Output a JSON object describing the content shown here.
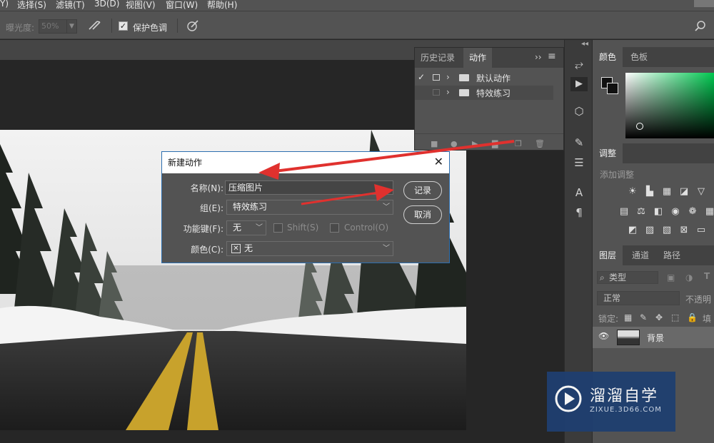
{
  "menu": [
    "Y)",
    "选择(S)",
    "滤镜(T)",
    "3D(D)",
    "视图(V)",
    "窗口(W)",
    "帮助(H)"
  ],
  "options_bar": {
    "exposure_label": "曝光度:",
    "exposure_value": "50%",
    "protect_tones_label": "保护色调",
    "protect_tones_checked": true
  },
  "actions_panel": {
    "tabs": [
      "历史记录",
      "动作"
    ],
    "active_tab": "动作",
    "sets": [
      {
        "name": "默认动作",
        "checked": true
      },
      {
        "name": "特效练习",
        "checked": false
      }
    ]
  },
  "dialog": {
    "title": "新建动作",
    "name_label": "名称(N):",
    "name_value": "压缩图片",
    "set_label": "组(E):",
    "set_value": "特效练习",
    "function_key_label": "功能键(F):",
    "function_key_value": "无",
    "shift_label": "Shift(S)",
    "control_label": "Control(O)",
    "color_label": "颜色(C):",
    "color_value": "无",
    "record_button": "记录",
    "cancel_button": "取消"
  },
  "color_panel": {
    "tabs": [
      "颜色",
      "色板"
    ],
    "active_tab": "颜色"
  },
  "adjustments_panel": {
    "tab": "调整",
    "add_label": "添加调整"
  },
  "layers_panel": {
    "tabs": [
      "图层",
      "通道",
      "路径"
    ],
    "active_tab": "图层",
    "filter_kind": "类型",
    "blend_mode": "正常",
    "opacity_label": "不透明",
    "lock_label": "锁定:",
    "fill_label": "填",
    "layers": [
      {
        "name": "背景",
        "visible": true
      }
    ]
  },
  "watermark": {
    "brand": "溜溜自学",
    "url": "ZIXUE.3D66.COM"
  },
  "colors": {
    "ui_bg": "#535353",
    "dialog_accent": "#2d6fb0",
    "arrow": "#e0312e",
    "hue_green": "#00c850"
  }
}
